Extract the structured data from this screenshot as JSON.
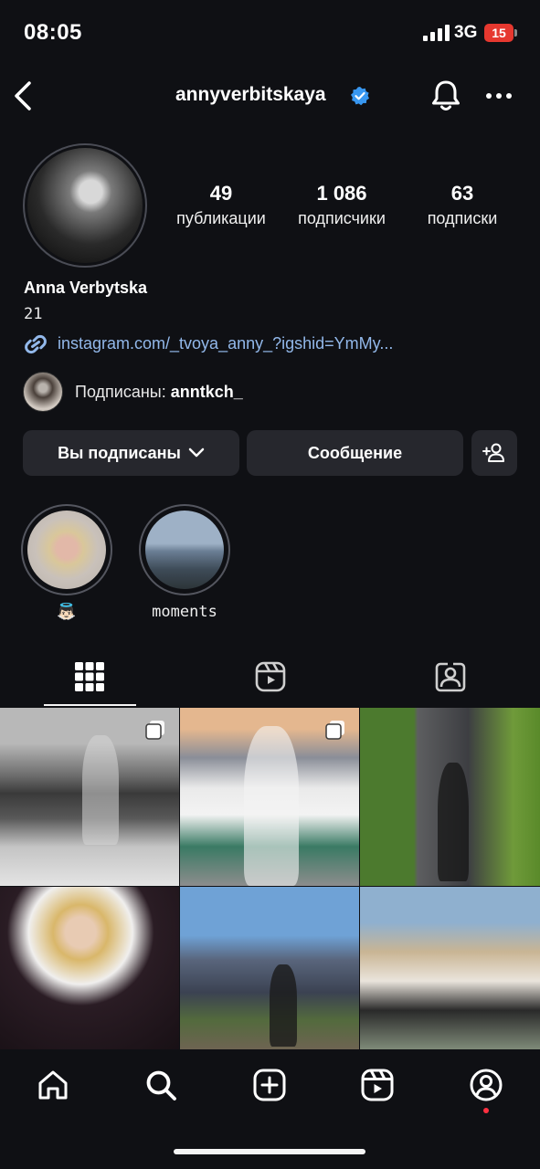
{
  "status_bar": {
    "time": "08:05",
    "network": "3G",
    "battery_level": "15",
    "battery_color": "#e6382f"
  },
  "header": {
    "username": "annyverbitskaya",
    "verified_icon": "verified-badge-icon",
    "back_icon": "chevron-left-icon",
    "notifications_icon": "bell-icon",
    "more_icon": "more-horizontal-icon"
  },
  "profile": {
    "stats": [
      {
        "value": "49",
        "label": "публикации"
      },
      {
        "value": "1 086",
        "label": "подписчики"
      },
      {
        "value": "63",
        "label": "подписки"
      }
    ],
    "full_name": "Anna Verbytska",
    "bio": "21",
    "link": "instagram.com/_tvoya_anny_?igshid=YmMy...",
    "followed_by_prefix": "Подписаны: ",
    "followed_by_user": "anntkch_"
  },
  "actions": {
    "following_label": "Вы подписаны",
    "message_label": "Сообщение",
    "add_user_icon": "add-user-icon"
  },
  "highlights": [
    {
      "label": "👼🏻"
    },
    {
      "label": "moments"
    }
  ],
  "tabs": [
    {
      "icon": "grid-icon",
      "active": true
    },
    {
      "icon": "reels-icon",
      "active": false
    },
    {
      "icon": "tagged-icon",
      "active": false
    }
  ],
  "posts": [
    {
      "multi": true
    },
    {
      "multi": true
    },
    {
      "multi": false
    },
    {
      "multi": false
    },
    {
      "multi": false
    },
    {
      "multi": false
    }
  ],
  "bottom_nav": [
    {
      "icon": "home-icon"
    },
    {
      "icon": "search-icon"
    },
    {
      "icon": "create-icon"
    },
    {
      "icon": "reels-icon"
    },
    {
      "icon": "profile-icon"
    }
  ],
  "colors": {
    "background": "#0f1014",
    "button": "#26272d",
    "link": "#92b8ea",
    "verified": "#3897f0",
    "notification_dot": "#ff3040"
  }
}
